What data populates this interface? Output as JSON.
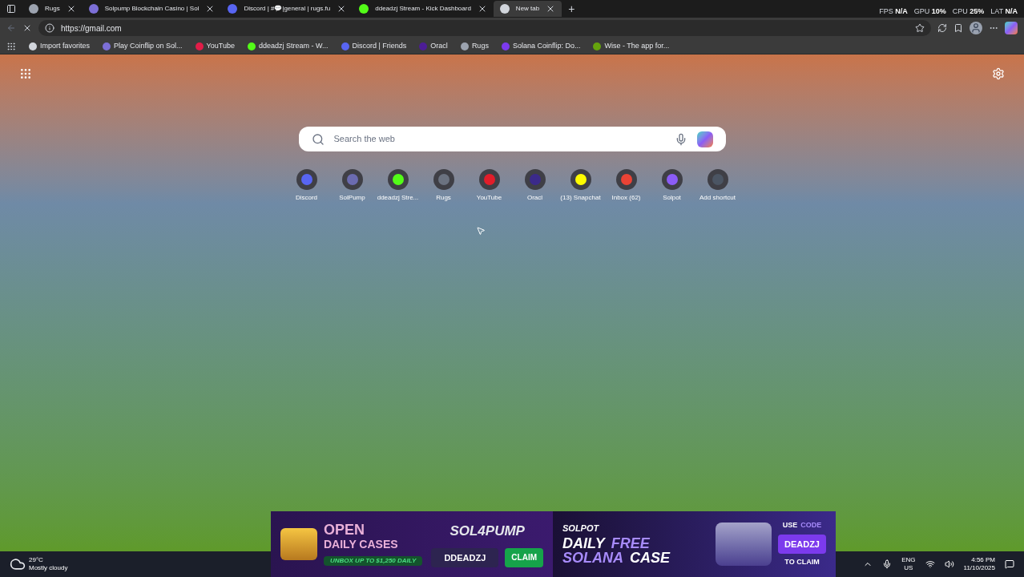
{
  "tabs": [
    {
      "title": "Rugs",
      "selected": false,
      "color": "#9ca3af"
    },
    {
      "title": "Solpump Blockchain Casino | Sol",
      "selected": false,
      "color": "#7c6fd6"
    },
    {
      "title": "Discord | #💬|general | rugs.fu",
      "selected": false,
      "color": "#5865f2"
    },
    {
      "title": "ddeadzj Stream - Kick Dashboard",
      "selected": false,
      "color": "#53fc18"
    },
    {
      "title": "New tab",
      "selected": true,
      "color": "#d1d5db"
    }
  ],
  "new_tab_button": "+",
  "perf": [
    {
      "label": "FPS",
      "value": "N/A"
    },
    {
      "label": "GPU",
      "value": "10%"
    },
    {
      "label": "CPU",
      "value": "25%"
    },
    {
      "label": "LAT",
      "value": "N/A"
    }
  ],
  "address": {
    "value": "https://gmail.com"
  },
  "bookmarks": [
    {
      "title": "Import favorites",
      "color": "#d1d5db"
    },
    {
      "title": "Play Coinflip on Sol...",
      "color": "#7c6fd6"
    },
    {
      "title": "YouTube",
      "color": "#e11d48"
    },
    {
      "title": "ddeadzj Stream - W...",
      "color": "#53fc18"
    },
    {
      "title": "Discord | Friends",
      "color": "#5865f2"
    },
    {
      "title": "Oracl",
      "color": "#4c1d95"
    },
    {
      "title": "Rugs",
      "color": "#9ca3af"
    },
    {
      "title": "Solana Coinflip: Do...",
      "color": "#7c3aed"
    },
    {
      "title": "Wise - The app for...",
      "color": "#65a30d"
    }
  ],
  "search": {
    "placeholder": "Search the web"
  },
  "shortcuts": [
    {
      "label": "Discord",
      "color": "#5865f2"
    },
    {
      "label": "SolPump",
      "color": "#6b6bb0"
    },
    {
      "label": "ddeadzj Stre...",
      "color": "#53fc18"
    },
    {
      "label": "Rugs",
      "color": "#6b7280"
    },
    {
      "label": "YouTube",
      "color": "#e11d2a"
    },
    {
      "label": "Oracl",
      "color": "#3b2a8a"
    },
    {
      "label": "(13) Snapchat",
      "color": "#fffc00"
    },
    {
      "label": "Inbox (62)",
      "color": "#ea4335"
    },
    {
      "label": "Solpot",
      "color": "#8b5cf6"
    },
    {
      "label": "Add shortcut",
      "color": "#4b5563"
    }
  ],
  "banner": {
    "open": "OPEN",
    "daily_cases": "DAILY CASES",
    "unbox": "UNBOX UP TO $1,250 DAILY",
    "brand": "SOL4PUMP",
    "code": "DDEADZJ",
    "claim": "CLAIM",
    "solpot": "SOLPOT",
    "headline_1": "DAILY",
    "headline_2": "FREE",
    "headline_3": "SOLANA",
    "headline_4": "CASE",
    "use": "USE",
    "code_word": "CODE",
    "code_2": "DEADZJ",
    "to_claim": "TO CLAIM"
  },
  "taskbar": {
    "temperature": "29°C",
    "weather": "Mostly cloudy",
    "language": "ENG",
    "region": "US",
    "time": "4:56 PM",
    "date": "11/10/2025"
  }
}
